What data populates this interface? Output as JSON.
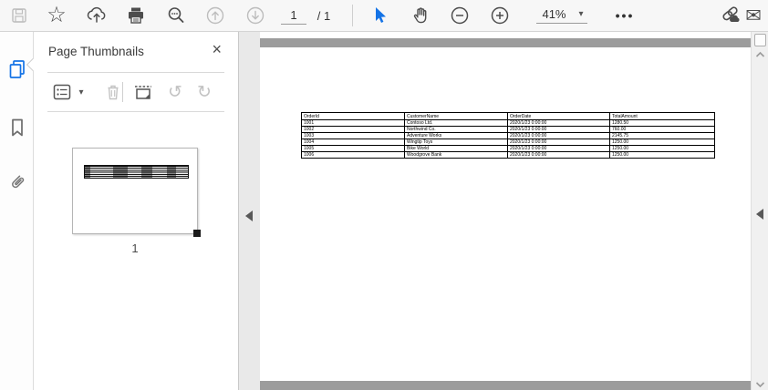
{
  "toolbar": {
    "page_current": "1",
    "page_total_label": "/ 1",
    "zoom_value": "41%",
    "more_label": "•••"
  },
  "icons": {
    "star_glyph": "☆",
    "minus_glyph": "−",
    "plus_glyph": "+",
    "caret_glyph": "▾",
    "rotate_ccw_glyph": "↺",
    "rotate_cw_glyph": "↻",
    "close_glyph": "×",
    "envelope_glyph": "✉"
  },
  "thumbnails_panel": {
    "title": "Page Thumbnails",
    "page_label": "1"
  },
  "document": {
    "table": {
      "headers": [
        "OrderId",
        "CustomerName",
        "OrderDate",
        "TotalAmount"
      ],
      "rows": [
        [
          "1001",
          "Contoso Ltd.",
          "2020/1/23 0:00:00",
          "1280.50"
        ],
        [
          "1002",
          "Northwind Co.",
          "2020/1/23 0:00:00",
          "760.00"
        ],
        [
          "1003",
          "Adventure Works",
          "2020/1/23 0:00:00",
          "2145.75"
        ],
        [
          "1004",
          "Wingtip Toys",
          "2020/1/23 0:00:00",
          "1250.00"
        ],
        [
          "1005",
          "Bike World",
          "2020/1/23 0:00:00",
          "1250.00"
        ],
        [
          "1006",
          "Woodgrove Bank",
          "2020/1/23 0:00:00",
          "1250.00"
        ]
      ]
    }
  },
  "colors": {
    "accent": "#1473e6",
    "toolbar_bg": "#f7f7f7",
    "doc_bg": "#9c9c9c"
  }
}
